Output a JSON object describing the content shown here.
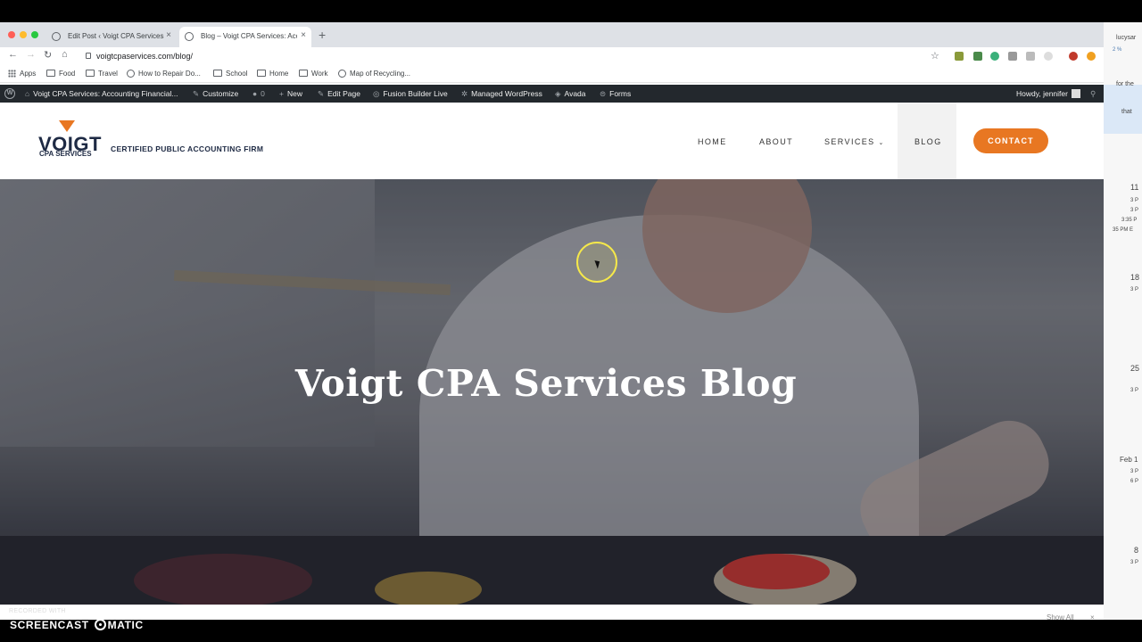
{
  "browser": {
    "tabs": [
      {
        "label": "Edit Post ‹ Voigt CPA Services",
        "active": false
      },
      {
        "label": "Blog – Voigt CPA Services: Acc",
        "active": true
      }
    ],
    "new_tab": "+",
    "url": "voigtcpaservices.com/blog/",
    "bookmarks": [
      "Apps",
      "Food",
      "Travel",
      "How to Repair Do...",
      "School",
      "Home",
      "Work",
      "Map of Recycling..."
    ]
  },
  "adminbar": {
    "site_name": "Voigt CPA Services: Accounting Financial...",
    "customize": "Customize",
    "comments_count": "0",
    "new": "New",
    "edit_page": "Edit Page",
    "fusion": "Fusion Builder Live",
    "managed_wp": "Managed WordPress",
    "avada": "Avada",
    "forms": "Forms",
    "howdy": "Howdy, jennifer"
  },
  "site": {
    "logo_main": "VOIGT",
    "logo_sub": "CPA SERVICES",
    "tagline": "CERTIFIED PUBLIC ACCOUNTING FIRM",
    "nav": {
      "home": "HOME",
      "about": "ABOUT",
      "services": "SERVICES",
      "blog": "BLOG"
    },
    "contact": "CONTACT",
    "accent": "#e87722"
  },
  "hero": {
    "title": "Voigt CPA Services Blog"
  },
  "right_panel": {
    "items": [
      "lucysar",
      "2 %",
      "for the",
      "that",
      "11",
      "3 P",
      "3 P",
      "3:35 P",
      "35 PM E",
      "18",
      "3 P",
      "25",
      "3 P",
      "Feb 1",
      "3 P",
      "6 P",
      "8",
      "3 P"
    ]
  },
  "recorder": {
    "small": "RECORDED WITH",
    "brand_left": "SCREENCAST",
    "brand_right": "MATIC",
    "show_all": "Show All",
    "close": "×"
  }
}
